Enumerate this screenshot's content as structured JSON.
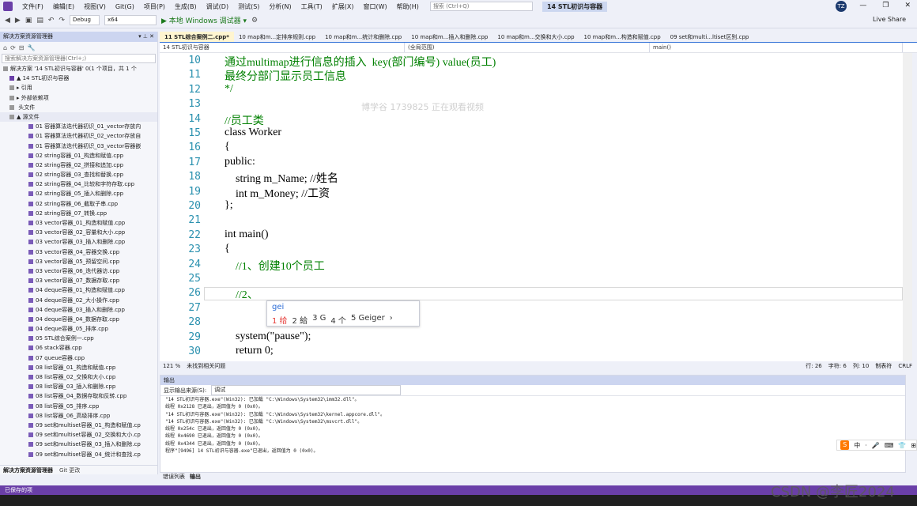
{
  "menubar": {
    "items": [
      "文件(F)",
      "编辑(E)",
      "视图(V)",
      "Git(G)",
      "项目(P)",
      "生成(B)",
      "调试(D)",
      "测试(S)",
      "分析(N)",
      "工具(T)",
      "扩展(X)",
      "窗口(W)",
      "帮助(H)"
    ],
    "search_placeholder": "搜索 (Ctrl+Q)",
    "solution_name": "14 STL初识与容器",
    "avatar": "TZ"
  },
  "toolbar": {
    "config": "Debug",
    "platform": "x64",
    "run_label": "▶ 本地 Windows 调试器 ▾",
    "live_share": "Live Share"
  },
  "solution_explorer": {
    "title": "解决方案资源管理器",
    "search_placeholder": "搜索解决方案资源管理器(Ctrl+;)",
    "rows": [
      "解决方案 '14 STL初识与容器' 0(1 个项目，共 1 个",
      "▲ 14 STL初识与容器",
      "▸ 引用",
      "▸ 外部依赖项",
      "  头文件",
      "▲ 源文件",
      "01 容器算法迭代器初识_01_vector存放内",
      "01 容器算法迭代器初识_02_vector存放自",
      "01 容器算法迭代器初识_03_vector容器嵌",
      "02 string容器_01_构造和赋值.cpp",
      "02 string容器_02_拼接和追加.cpp",
      "02 string容器_03_查找和替换.cpp",
      "02 string容器_04_比较和字符存取.cpp",
      "02 string容器_05_插入和删除.cpp",
      "02 string容器_06_截取子串.cpp",
      "02 string容器_07_转换.cpp",
      "03 vector容器_01_构造和赋值.cpp",
      "03 vector容器_02_容量和大小.cpp",
      "03 vector容器_03_插入和删除.cpp",
      "03 vector容器_04_容器交换.cpp",
      "03 vector容器_05_预留空间.cpp",
      "03 vector容器_06_迭代器访.cpp",
      "03 vector容器_07_数据存取.cpp",
      "04 deque容器_01_构造和赋值.cpp",
      "04 deque容器_02_大小操作.cpp",
      "04 deque容器_03_插入和删除.cpp",
      "04 deque容器_04_数据存取.cpp",
      "04 deque容器_05_排序.cpp",
      "05 STL综合案例一.cpp",
      "06 stack容器.cpp",
      "07 queue容器.cpp",
      "08 list容器_01_构造和赋值.cpp",
      "08 list容器_02_交换和大小.cpp",
      "08 list容器_03_插入和删除.cpp",
      "08 list容器_04_数据存取和反转.cpp",
      "08 list容器_05_排序.cpp",
      "08 list容器_06_高级排序.cpp",
      "09 set和multiset容器_01_构造和赋值.cp",
      "09 set和multiset容器_02_交换和大小.cp",
      "09 set和multiset容器_03_插入和删除.cp",
      "09 set和multiset容器_04_统计和查找.cp"
    ],
    "tab_active": "解决方案资源管理器",
    "tab_other": "Git 更改"
  },
  "editor_tabs": [
    "11 STL综合案例二.cpp*",
    "10 map和m...定排序规则.cpp",
    "10 map和m...统计和删除.cpp",
    "10 map和m...插入和删除.cpp",
    "10 map和m...交换和大小.cpp",
    "10 map和m...构造和赋值.cpp",
    "09 set和multi...ltiset区别.cpp"
  ],
  "navbar": {
    "project": "14 STL初识与容器",
    "scope": "(全局范围)",
    "member": "main()"
  },
  "code": {
    "lines": [
      {
        "n": "10",
        "t": "通过multimap进行信息的插入  key(部门编号) value(员工)"
      },
      {
        "n": "11",
        "t": "最终分部门显示员工信息"
      },
      {
        "n": "12",
        "t": "*/"
      },
      {
        "n": "13",
        "t": ""
      },
      {
        "n": "14",
        "t": "//员工类"
      },
      {
        "n": "15",
        "t": "class Worker"
      },
      {
        "n": "16",
        "t": "{"
      },
      {
        "n": "17",
        "t": "public:"
      },
      {
        "n": "18",
        "t": "    string m_Name; //姓名"
      },
      {
        "n": "19",
        "t": "    int m_Money; //工资"
      },
      {
        "n": "20",
        "t": "};"
      },
      {
        "n": "21",
        "t": ""
      },
      {
        "n": "22",
        "t": "int main()"
      },
      {
        "n": "23",
        "t": "{"
      },
      {
        "n": "24",
        "t": "    //1、创建10个员工"
      },
      {
        "n": "25",
        "t": ""
      },
      {
        "n": "26",
        "t": "    //2、"
      },
      {
        "n": "27",
        "t": ""
      },
      {
        "n": "28",
        "t": ""
      },
      {
        "n": "29",
        "t": "    system(\"pause\");"
      },
      {
        "n": "30",
        "t": "    return 0;"
      }
    ],
    "ghost_watermark": "博学谷 1739825 正在观看视频"
  },
  "ime_popup": {
    "input": "gei",
    "candidates": [
      "1 给",
      "2 給",
      "3 G",
      "4 个",
      "5 Geiger",
      "›"
    ]
  },
  "editor_status": {
    "zoom": "121 %",
    "issues": "未找到相关问题",
    "line": "行: 26",
    "char": "字符: 6",
    "col": "列: 10",
    "tabs": "制表符",
    "eol": "CRLF"
  },
  "output": {
    "title": "输出",
    "source_label": "显示输出来源(S):",
    "source_value": "调试",
    "lines": [
      "\"14 STL初识与容器.exe\"(Win32): 已加载 \"C:\\Windows\\System32\\imm32.dll\"。",
      "线程 0x2128 已退出，返回值为 0 (0x0)。",
      "\"14 STL初识与容器.exe\"(Win32): 已加载 \"C:\\Windows\\System32\\kernel.appcore.dll\"。",
      "\"14 STL初识与容器.exe\"(Win32): 已加载 \"C:\\Windows\\System32\\msvcrt.dll\"。",
      "线程 0x254c 已退出，返回值为 0 (0x0)。",
      "线程 0x4690 已退出，返回值为 0 (0x0)。",
      "线程 0x4344 已退出，返回值为 0 (0x0)。",
      "程序\"[9496] 14 STL初识与容器.exe\"已退出，返回值为 0 (0x0)。"
    ],
    "tab_errors": "错误列表",
    "tab_output": "输出"
  },
  "statusbar": {
    "text": "已保存的项"
  },
  "ime_bar": {
    "items": [
      "中",
      "·",
      "🎤",
      "⌨",
      "👕",
      "⊞"
    ]
  },
  "watermark": "CSDN @李匠2024"
}
